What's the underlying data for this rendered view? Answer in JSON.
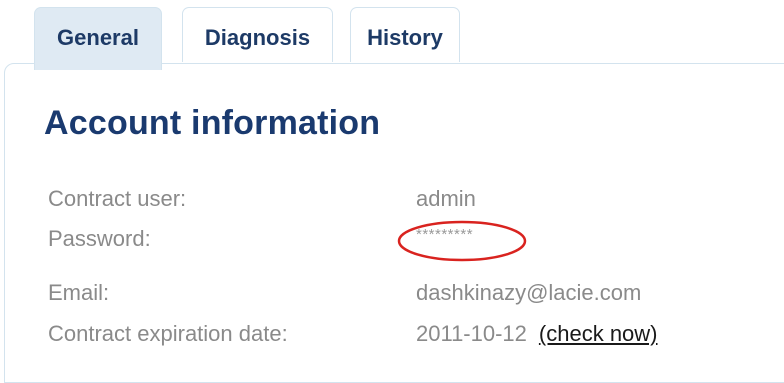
{
  "tabs": [
    {
      "label": "General",
      "active": true
    },
    {
      "label": "Diagnosis",
      "active": false
    },
    {
      "label": "History",
      "active": false
    }
  ],
  "section": {
    "title": "Account information"
  },
  "fields": {
    "contract_user": {
      "label": "Contract user:",
      "value": "admin"
    },
    "password": {
      "label": "Password:",
      "value": "*********"
    },
    "email": {
      "label": "Email:",
      "value": "dashkinazy@lacie.com"
    },
    "expiration": {
      "label": "Contract expiration date:",
      "value": "2011-10-12",
      "link": "(check now)"
    }
  },
  "colors": {
    "tab_active_bg": "#dfeaf3",
    "border": "#d3e3ee",
    "title": "#1a3a6f",
    "label_text": "#8a8a8a",
    "annotation": "#d9231f"
  }
}
